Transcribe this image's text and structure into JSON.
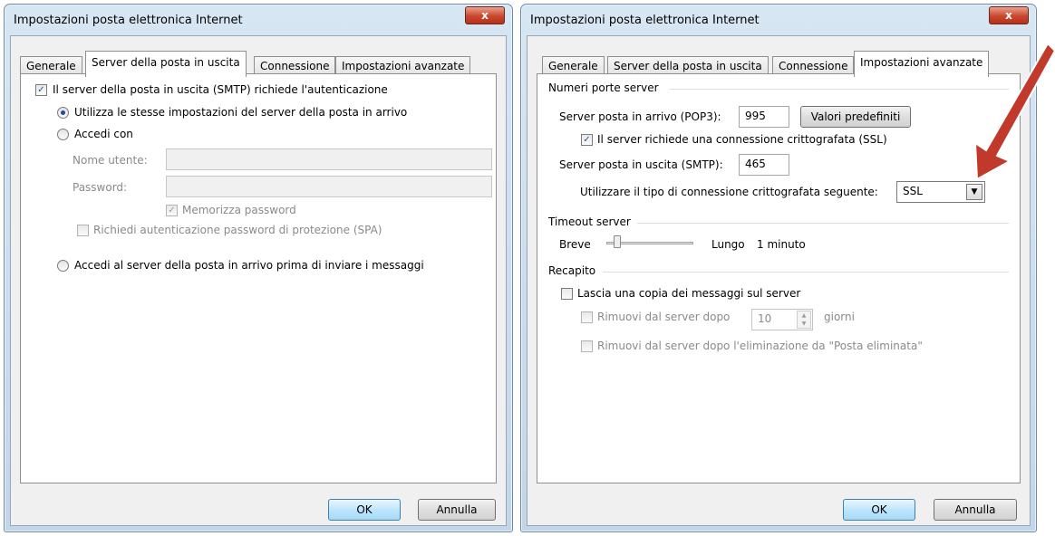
{
  "left_dialog": {
    "title": "Impostazioni posta elettronica Internet",
    "close_label": "x",
    "tabs": [
      "Generale",
      "Server della posta in uscita",
      "Connessione",
      "Impostazioni avanzate"
    ],
    "smtp_auth_label": "Il server della posta in uscita (SMTP) richiede l'autenticazione",
    "same_settings_label": "Utilizza le stesse impostazioni del server della posta in arrivo",
    "login_with_label": "Accedi con",
    "username_label": "Nome utente:",
    "password_label": "Password:",
    "remember_password_label": "Memorizza password",
    "spa_label": "Richiedi autenticazione password di protezione (SPA)",
    "login_incoming_first_label": "Accedi al server della posta in arrivo prima di inviare i messaggi",
    "ok_label": "OK",
    "cancel_label": "Annulla"
  },
  "right_dialog": {
    "title": "Impostazioni posta elettronica Internet",
    "close_label": "x",
    "tabs": [
      "Generale",
      "Server della posta in uscita",
      "Connessione",
      "Impostazioni avanzate"
    ],
    "ports_group": "Numeri porte server",
    "pop3_label": "Server posta in arrivo (POP3):",
    "pop3_value": "995",
    "defaults_button": "Valori predefiniti",
    "ssl_label": "Il server richiede una connessione crittografata (SSL)",
    "smtp_label": "Server posta in uscita (SMTP):",
    "smtp_value": "465",
    "encryption_label": "Utilizzare il tipo di connessione crittografata seguente:",
    "encryption_value": "SSL",
    "timeout_group": "Timeout server",
    "timeout_short": "Breve",
    "timeout_long": "Lungo",
    "timeout_value": "1 minuto",
    "delivery_group": "Recapito",
    "leave_copy_label": "Lascia una copia dei messaggi sul server",
    "remove_after_label": "Rimuovi dal server dopo",
    "remove_after_value": "10",
    "days_label": "giorni",
    "remove_deleted_label": "Rimuovi dal server dopo l'eliminazione da \"Posta eliminata\"",
    "ok_label": "OK",
    "cancel_label": "Annulla"
  },
  "colors": {
    "arrow": "#c0392b",
    "accent": "#1f4c9a"
  }
}
